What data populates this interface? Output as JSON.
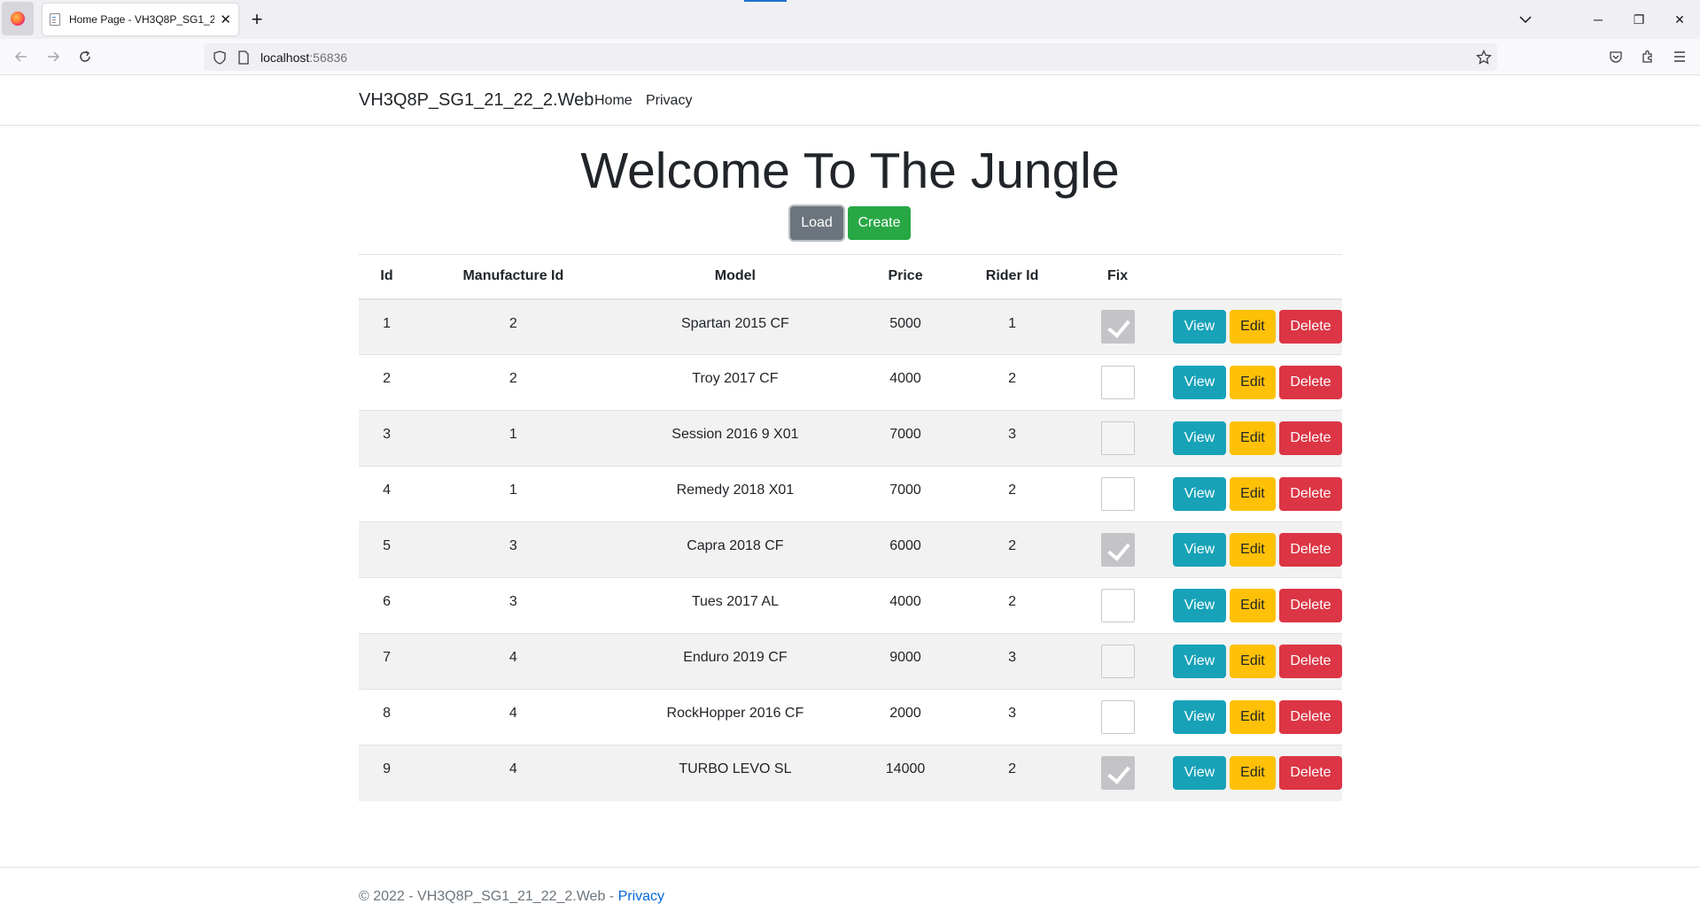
{
  "browser": {
    "tab_title": "Home Page - VH3Q8P_SG1_21_22_2.Web",
    "url_host": "localhost",
    "url_port": ":56836",
    "tab_close": "✕",
    "new_tab": "+",
    "minimize": "─",
    "restore": "❐",
    "close": "✕"
  },
  "header": {
    "brand": "VH3Q8P_SG1_21_22_2.Web",
    "nav": [
      "Home",
      "Privacy"
    ]
  },
  "main": {
    "title": "Welcome To The Jungle",
    "load_label": "Load",
    "create_label": "Create",
    "columns": [
      "Id",
      "Manufacture Id",
      "Model",
      "Price",
      "Rider Id",
      "Fix",
      ""
    ],
    "action_labels": {
      "view": "View",
      "edit": "Edit",
      "delete": "Delete"
    },
    "rows": [
      {
        "id": "1",
        "manufacture_id": "2",
        "model": "Spartan 2015 CF",
        "price": "5000",
        "rider_id": "1",
        "fix": true
      },
      {
        "id": "2",
        "manufacture_id": "2",
        "model": "Troy 2017 CF",
        "price": "4000",
        "rider_id": "2",
        "fix": false
      },
      {
        "id": "3",
        "manufacture_id": "1",
        "model": "Session 2016 9 X01",
        "price": "7000",
        "rider_id": "3",
        "fix": false
      },
      {
        "id": "4",
        "manufacture_id": "1",
        "model": "Remedy 2018 X01",
        "price": "7000",
        "rider_id": "2",
        "fix": false
      },
      {
        "id": "5",
        "manufacture_id": "3",
        "model": "Capra 2018 CF",
        "price": "6000",
        "rider_id": "2",
        "fix": true
      },
      {
        "id": "6",
        "manufacture_id": "3",
        "model": "Tues 2017 AL",
        "price": "4000",
        "rider_id": "2",
        "fix": false
      },
      {
        "id": "7",
        "manufacture_id": "4",
        "model": "Enduro 2019 CF",
        "price": "9000",
        "rider_id": "3",
        "fix": false
      },
      {
        "id": "8",
        "manufacture_id": "4",
        "model": "RockHopper 2016 CF",
        "price": "2000",
        "rider_id": "3",
        "fix": false
      },
      {
        "id": "9",
        "manufacture_id": "4",
        "model": "TURBO LEVO SL",
        "price": "14000",
        "rider_id": "2",
        "fix": true
      }
    ]
  },
  "footer": {
    "text": "© 2022 - VH3Q8P_SG1_21_22_2.Web - ",
    "link": "Privacy"
  },
  "colors": {
    "view": "#17a2b8",
    "edit": "#ffc107",
    "delete": "#dc3545",
    "load": "#6c757d",
    "create": "#28a745"
  }
}
